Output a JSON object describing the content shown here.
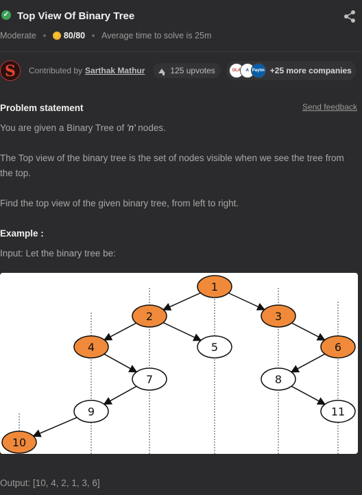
{
  "header": {
    "title": "Top View Of Binary Tree",
    "difficulty": "Moderate",
    "score": "80/80",
    "avg_time": "Average time to solve is 25m"
  },
  "contributor": {
    "avatar_letter": "S",
    "label": "Contributed by",
    "name": "Sarthak Mathur",
    "upvotes": "125 upvotes",
    "company_logos": [
      "OLA",
      "A",
      "Paytm"
    ],
    "more_companies": "+25 more companies"
  },
  "problem": {
    "heading": "Problem statement",
    "feedback": "Send feedback",
    "p1_before": "You are given a Binary Tree of ",
    "p1_em": "'n'",
    "p1_after": " nodes.",
    "p2": "The Top view of the binary tree is the set of nodes visible when we see the tree from the top.",
    "p3": "Find the top view of the given binary tree, from left to right."
  },
  "example": {
    "heading": "Example :",
    "input": "Input: Let the binary tree be:",
    "output": "Output: [10, 4, 2, 1, 3, 6]"
  },
  "tree": {
    "highlight_color": "#f08a3a",
    "nodes": [
      {
        "label": "1",
        "highlight": true
      },
      {
        "label": "2",
        "highlight": true
      },
      {
        "label": "3",
        "highlight": true
      },
      {
        "label": "4",
        "highlight": true
      },
      {
        "label": "5",
        "highlight": false
      },
      {
        "label": "6",
        "highlight": true
      },
      {
        "label": "7",
        "highlight": false
      },
      {
        "label": "8",
        "highlight": false
      },
      {
        "label": "9",
        "highlight": false
      },
      {
        "label": "11",
        "highlight": false
      },
      {
        "label": "10",
        "highlight": true
      }
    ]
  }
}
